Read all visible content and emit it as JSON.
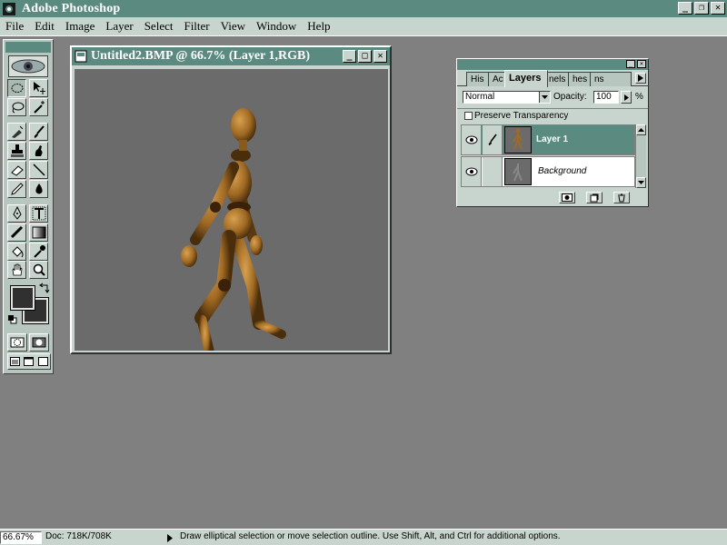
{
  "app": {
    "title": "Adobe Photoshop",
    "window_buttons": [
      "_",
      "❐",
      "✕"
    ]
  },
  "menu": [
    "File",
    "Edit",
    "Image",
    "Layer",
    "Select",
    "Filter",
    "View",
    "Window",
    "Help"
  ],
  "toolbox": {
    "tools": [
      "marquee",
      "move",
      "lasso",
      "magic-wand",
      "airbrush",
      "paintbrush",
      "rubber-stamp",
      "smudge",
      "eraser",
      "line",
      "pencil",
      "blur",
      "pen",
      "type",
      "gradient",
      "paint-bucket",
      "eyedropper",
      "hand",
      "zoom"
    ],
    "fg_color": "#303030",
    "bg_color": "#303030"
  },
  "document": {
    "title": "Untitled2.BMP @ 66.7% (Layer 1,RGB)",
    "window_buttons": [
      "_",
      "□",
      "✕"
    ]
  },
  "layers_palette": {
    "tabs": [
      "His",
      "Ac",
      "Layers",
      "nels",
      "hes",
      "ns"
    ],
    "blend_mode": "Normal",
    "opacity_label": "Opacity:",
    "opacity_value": "100",
    "opacity_unit": "%",
    "preserve_transparency": "Preserve Transparency",
    "layers": [
      {
        "name": "Layer 1",
        "selected": true
      },
      {
        "name": "Background",
        "selected": false
      }
    ]
  },
  "status_bar": {
    "zoom": "66.67%",
    "doc": "Doc: 718K/708K",
    "message": "Draw elliptical selection or move selection outline.  Use Shift, Alt, and Ctrl for additional options."
  },
  "colors": {
    "title_bar": "#5a8a80",
    "chrome": "#c8d4ce",
    "desktop": "#808080",
    "canvas": "#6b6b6b"
  }
}
